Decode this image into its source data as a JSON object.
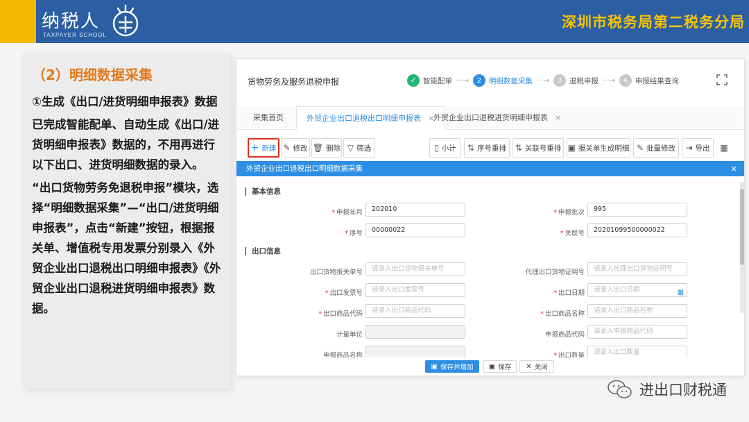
{
  "header": {
    "logo_text": "纳税人",
    "logo_sub": "TAXPAYER SCHOOL",
    "bureau": "深圳市税务局第二税务分局",
    "colors": {
      "bar": "#2b5ea3",
      "accent": "#f5b800",
      "bureau_text": "#f7c400"
    }
  },
  "left": {
    "section_title": "（2）明细数据采集",
    "paragraphs": [
      "①生成《出口/进货明细申报表》数据",
      "已完成智能配单、自动生成《出口/进货明细申报表》数据的，不用再进行以下出口、进货明细数据的录入。",
      "“出口货物劳务免退税申报”模块，选择“明细数据采集”—“出口/进货明细申报表”，点击“新建”按钮，根据报关单、增值税专用发票分别录入《外贸企业出口退税出口明细申报表》《外贸企业出口退税进货明细申报表》数据。"
    ]
  },
  "app": {
    "title": "货物劳务及服务退税申报",
    "steps": [
      {
        "num": "✓",
        "label": "智能配单",
        "state": "done"
      },
      {
        "num": "2",
        "label": "明细数据采集",
        "state": "active"
      },
      {
        "num": "3",
        "label": "退税申报",
        "state": "todo"
      },
      {
        "num": "4",
        "label": "申报结果查询",
        "state": "todo"
      }
    ],
    "tabs": [
      {
        "label": "采集首页",
        "closable": false
      },
      {
        "label": "外贸企业出口退税出口明细申报表",
        "closable": true,
        "active": true
      },
      {
        "label": "外贸企业出口退税进货明细申报表",
        "closable": true
      }
    ],
    "toolbar": {
      "new": "新建",
      "edit": "修改",
      "delete": "删除",
      "filter": "筛选",
      "subtotal": "小计",
      "reorder_seq": "序号重排",
      "reorder_link": "关联号重排",
      "gen_from_customs": "报关单生成明细",
      "batch_edit": "批量修改",
      "export": "导出"
    }
  },
  "modal": {
    "title": "外贸企业出口退税出口明细数据采集",
    "basic_title": "基本信息",
    "export_title": "出口信息",
    "fields": {
      "period": {
        "label": "申报年月",
        "value": "202010",
        "required": true
      },
      "batch": {
        "label": "申报批次",
        "value": "995",
        "required": true
      },
      "seq": {
        "label": "序号",
        "value": "00000022",
        "required": true
      },
      "link_no": {
        "label": "关联号",
        "value": "20201099500000022",
        "required": true
      },
      "customs_no": {
        "label": "出口货物报关单号",
        "placeholder": "请录入出口货物报关单号",
        "required": false
      },
      "agent_cert": {
        "label": "代理出口货物证明号",
        "placeholder": "请录入代理出口货物证明号",
        "required": false
      },
      "invoice_no": {
        "label": "出口发票号",
        "placeholder": "请录入出口发票号",
        "required": true
      },
      "export_date": {
        "label": "出口日期",
        "placeholder": "请录入出口日期",
        "required": true
      },
      "goods_code": {
        "label": "出口商品代码",
        "placeholder": "请录入出口商品代码",
        "required": true
      },
      "goods_name": {
        "label": "出口商品名称",
        "placeholder": "请录入出口商品名称",
        "required": true
      },
      "unit": {
        "label": "计量单位",
        "placeholder": "",
        "required": false
      },
      "decl_code": {
        "label": "申报商品代码",
        "placeholder": "请录入申报商品代码",
        "required": false
      },
      "decl_name": {
        "label": "申报商品名称",
        "placeholder": "",
        "required": false
      },
      "qty": {
        "label": "出口数量",
        "placeholder": "请录入出口数量",
        "required": true
      }
    },
    "footer": {
      "save_add": "保存并增加",
      "save": "保存",
      "close": "关闭"
    }
  },
  "watermark": {
    "text": "进出口财税通",
    "icon": "wechat-icon"
  }
}
